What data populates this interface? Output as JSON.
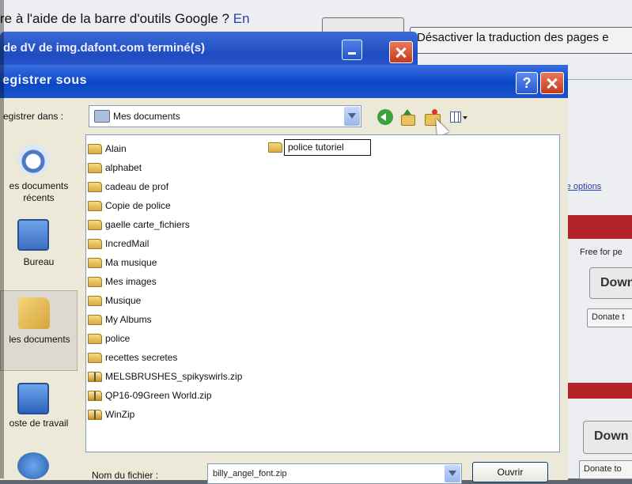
{
  "background": {
    "question_text": "re à l'aide de la barre d'outils Google ?",
    "question_link": "En",
    "toolbar_button": "",
    "disable_translation": "Désactiver la traduction des pages e",
    "more_options_link": "re options",
    "free_text": "Free for pe",
    "download_button": "Down",
    "donate_button": "Donate t",
    "download_button_2": "Down",
    "donate_button_2": "Donate to"
  },
  "download_window": {
    "title": "de dV de img.dafont.com terminé(s)"
  },
  "dialog": {
    "title": "egistrer sous",
    "help_label": "?",
    "save_in_label": "egistrer dans :",
    "save_in_value": "Mes documents",
    "places": [
      {
        "label": "es documents récents",
        "icon": "recent-documents-icon"
      },
      {
        "label": "Bureau",
        "icon": "desktop-icon"
      },
      {
        "label": "les documents",
        "icon": "my-documents-icon"
      },
      {
        "label": "oste de travail",
        "icon": "my-computer-icon"
      },
      {
        "label": "",
        "icon": "network-places-icon"
      }
    ],
    "files": [
      {
        "name": "Alain",
        "type": "folder"
      },
      {
        "name": "alphabet",
        "type": "folder"
      },
      {
        "name": "cadeau de prof",
        "type": "folder"
      },
      {
        "name": "Copie de police",
        "type": "folder"
      },
      {
        "name": "gaelle carte_fichiers",
        "type": "folder"
      },
      {
        "name": "IncredMail",
        "type": "folder"
      },
      {
        "name": "Ma musique",
        "type": "folder"
      },
      {
        "name": "Mes images",
        "type": "folder"
      },
      {
        "name": "Musique",
        "type": "folder"
      },
      {
        "name": "My Albums",
        "type": "folder"
      },
      {
        "name": "police",
        "type": "folder"
      },
      {
        "name": "recettes secretes",
        "type": "folder"
      },
      {
        "name": "MELSBRUSHES_spikyswirls.zip",
        "type": "zip"
      },
      {
        "name": "QP16-09Green World.zip",
        "type": "zip"
      },
      {
        "name": "WinZip",
        "type": "zip"
      }
    ],
    "renaming_folder": "police tutoriel",
    "filename_label": "Nom du fichier :",
    "filename_value": "billy_angel_font.zip",
    "open_button": "Ouvrir"
  },
  "colors": {
    "titlebar": "#0b47c7",
    "dialog_bg": "#ece9d8",
    "close_red": "#c63a1c",
    "page_red_bar": "#b5232a"
  }
}
